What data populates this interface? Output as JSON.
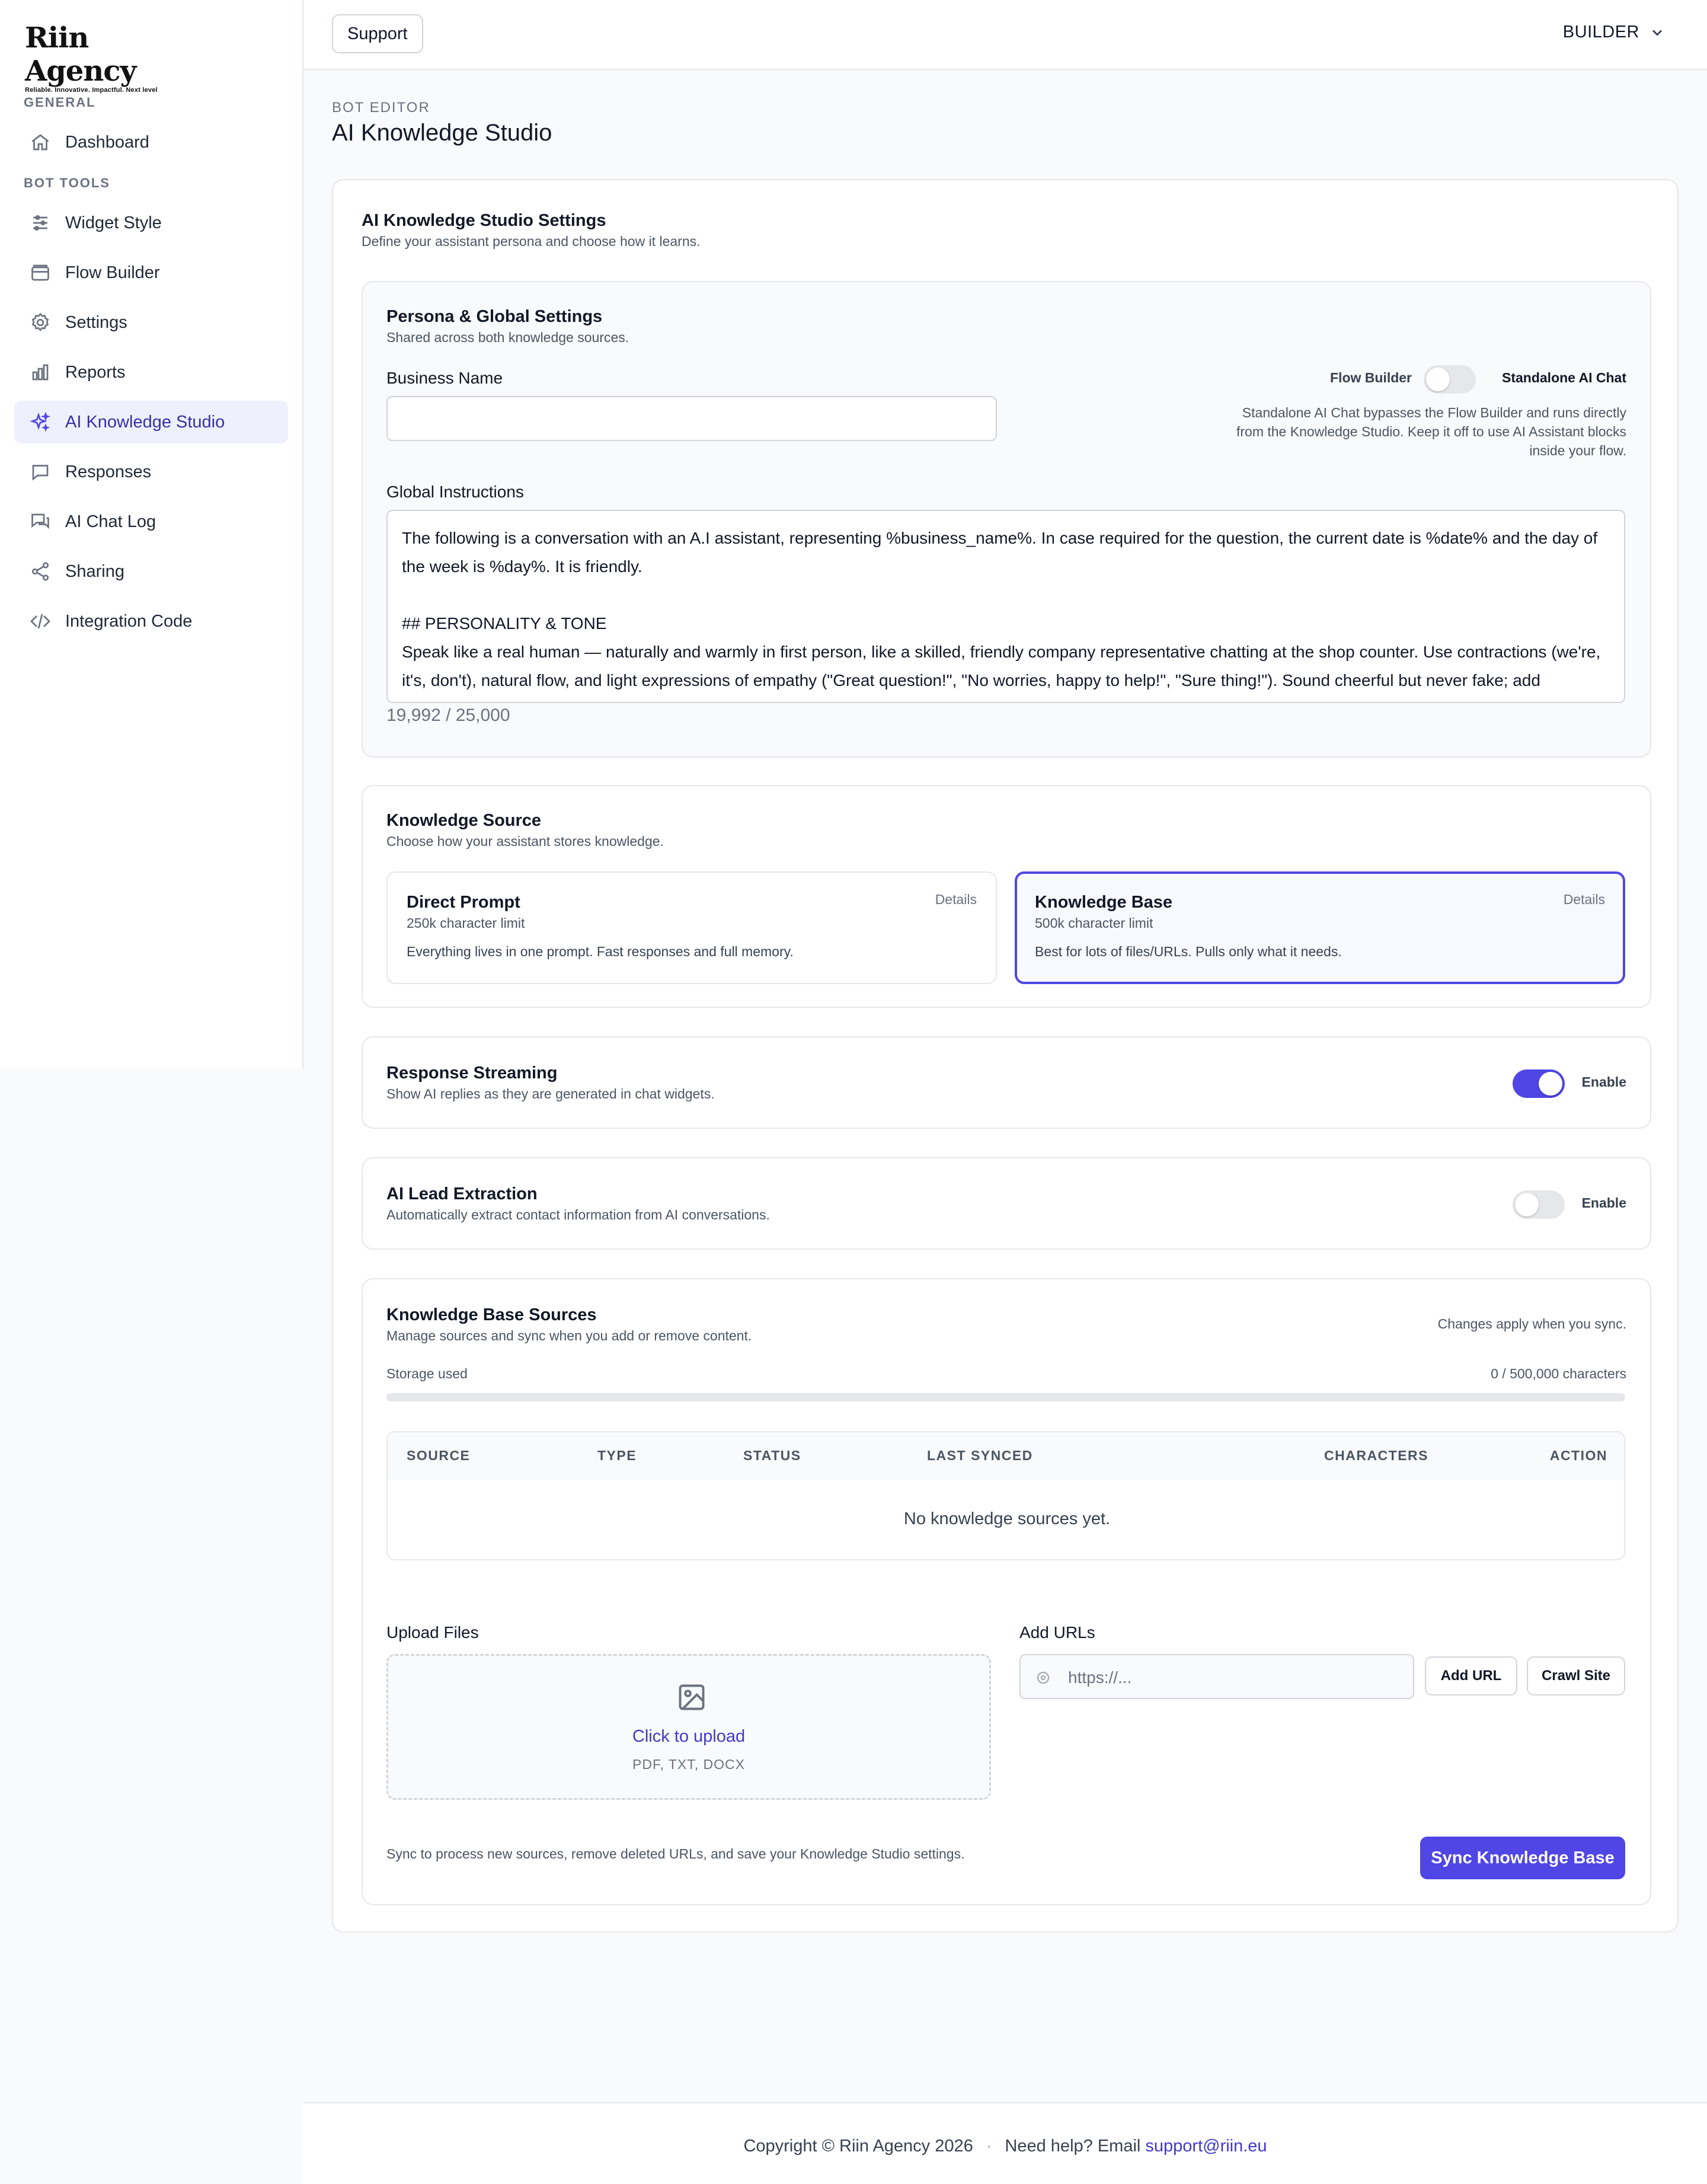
{
  "brand": {
    "name": "Riin Agency",
    "tagline": "Reliable. Innovative. Impactful. Next level"
  },
  "sidebar": {
    "section_general": "GENERAL",
    "section_bot_tools": "BOT TOOLS",
    "items": [
      {
        "label": "Dashboard",
        "icon": "home-icon"
      },
      {
        "label": "Widget Style",
        "icon": "sliders-icon"
      },
      {
        "label": "Flow Builder",
        "icon": "folder-icon"
      },
      {
        "label": "Settings",
        "icon": "gear-icon"
      },
      {
        "label": "Reports",
        "icon": "bar-chart-icon"
      },
      {
        "label": "AI Knowledge Studio",
        "icon": "sparkles-icon",
        "active": true
      },
      {
        "label": "Responses",
        "icon": "chat-bubble-icon"
      },
      {
        "label": "AI Chat Log",
        "icon": "chat-log-icon"
      },
      {
        "label": "Sharing",
        "icon": "share-icon"
      },
      {
        "label": "Integration Code",
        "icon": "code-icon"
      }
    ]
  },
  "header": {
    "support_label": "Support",
    "role_label": "BUILDER"
  },
  "page": {
    "crumb": "BOT EDITOR",
    "title": "AI Knowledge Studio"
  },
  "settings": {
    "title": "AI Knowledge Studio Settings",
    "subtitle": "Define your assistant persona and choose how it learns."
  },
  "persona": {
    "title": "Persona & Global Settings",
    "subtitle": "Shared across both knowledge sources.",
    "business_name_label": "Business Name",
    "business_name_value": "",
    "mode_left": "Flow Builder",
    "mode_right": "Standalone AI Chat",
    "mode_help": "Standalone AI Chat bypasses the Flow Builder and runs directly from the Knowledge Studio. Keep it off to use AI Assistant blocks inside your flow.",
    "global_instructions_label": "Global Instructions",
    "global_instructions_value": "The following is a conversation with an A.I assistant, representing %business_name%. In case required for the question, the current date is %date% and the day of the week is %day%. It is friendly.\n\n## PERSONALITY & TONE\nSpeak like a real human — naturally and warmly in first person, like a skilled, friendly company representative chatting at the shop counter. Use contractions (we're, it's, don't), natural flow, and light expressions of empathy (\"Great question!\", \"No worries, happy to help!\", \"Sure thing!\"). Sound cheerful but never fake; add personality and warmth without overpromising or over-selling.",
    "char_count": "19,992 / 25,000"
  },
  "knowledge_source": {
    "title": "Knowledge Source",
    "subtitle": "Choose how your assistant stores knowledge.",
    "options": [
      {
        "title": "Direct Prompt",
        "limit": "250k character limit",
        "desc": "Everything lives in one prompt. Fast responses and full memory.",
        "details": "Details"
      },
      {
        "title": "Knowledge Base",
        "limit": "500k character limit",
        "desc": "Best for lots of files/URLs. Pulls only what it needs.",
        "details": "Details"
      }
    ]
  },
  "streaming": {
    "title": "Response Streaming",
    "subtitle": "Show AI replies as they are generated in chat widgets.",
    "enable_label": "Enable",
    "enabled": true
  },
  "lead": {
    "title": "AI Lead Extraction",
    "subtitle": "Automatically extract contact information from AI conversations.",
    "enable_label": "Enable",
    "enabled": false
  },
  "kb_sources": {
    "title": "Knowledge Base Sources",
    "subtitle": "Manage sources and sync when you add or remove content.",
    "note": "Changes apply when you sync.",
    "storage_label": "Storage used",
    "storage_value": "0 / 500,000 characters",
    "storage_fraction": 0,
    "columns": [
      "SOURCE",
      "TYPE",
      "STATUS",
      "LAST SYNCED",
      "CHARACTERS",
      "ACTION"
    ],
    "empty_text": "No knowledge sources yet.",
    "upload_label": "Upload Files",
    "upload_link": "Click to upload",
    "upload_types": "PDF, TXT, DOCX",
    "urls_label": "Add URLs",
    "url_placeholder": "https://...",
    "add_url_label": "Add URL",
    "crawl_label": "Crawl Site",
    "sync_note": "Sync to process new sources, remove deleted URLs, and save your Knowledge Studio settings.",
    "sync_label": "Sync Knowledge Base"
  },
  "footer": {
    "copyright": "Copyright © Riin Agency 2026",
    "sep": "·",
    "help": "Need help? Email",
    "email": "support@riin.eu"
  },
  "colors": {
    "accent": "#4f46e5",
    "active_bg": "#eef0fe",
    "border": "#e5e7eb"
  }
}
